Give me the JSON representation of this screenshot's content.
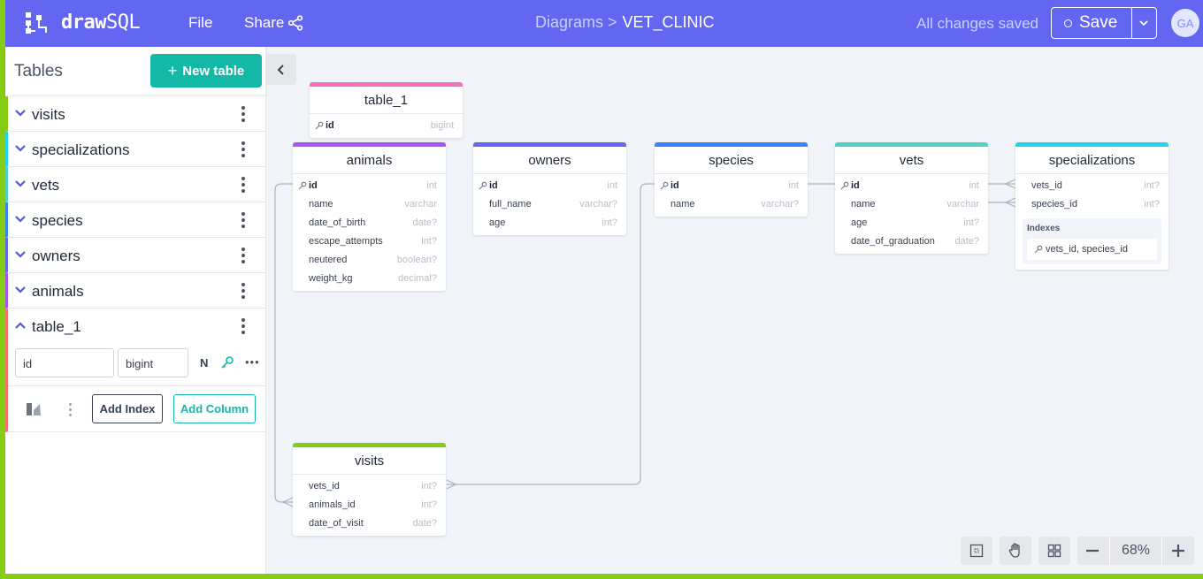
{
  "header": {
    "brand": "draw",
    "brand_suffix": "SQL",
    "file_label": "File",
    "share_label": "Share",
    "breadcrumb_parent": "Diagrams >",
    "breadcrumb_current": "VET_CLINIC",
    "status": "All changes saved",
    "save_label": "Save",
    "avatar_initials": "GA"
  },
  "sidebar": {
    "title": "Tables",
    "new_table_label": "New table",
    "tables": [
      {
        "name": "visits",
        "color": "#84cc16"
      },
      {
        "name": "specializations",
        "color": "#22d3ee"
      },
      {
        "name": "vets",
        "color": "#4fd1c5"
      },
      {
        "name": "species",
        "color": "#3b82f6"
      },
      {
        "name": "owners",
        "color": "#6366f1"
      },
      {
        "name": "animals",
        "color": "#a855f7"
      },
      {
        "name": "table_1",
        "color": "#f87171"
      }
    ],
    "expanded": {
      "column_name": "id",
      "column_type": "bigint",
      "nullable_label": "N",
      "add_index_label": "Add Index",
      "add_column_label": "Add Column"
    }
  },
  "diagram": {
    "indexes_label": "Indexes",
    "tables": {
      "table_1": {
        "title": "table_1",
        "color": "#f472b6",
        "columns": [
          {
            "name": "id",
            "type": "bigint",
            "pk": true
          }
        ]
      },
      "animals": {
        "title": "animals",
        "color": "#a855f7",
        "columns": [
          {
            "name": "id",
            "type": "int",
            "pk": true
          },
          {
            "name": "name",
            "type": "varchar"
          },
          {
            "name": "date_of_birth",
            "type": "date?"
          },
          {
            "name": "escape_attempts",
            "type": "int?"
          },
          {
            "name": "neutered",
            "type": "boolean?"
          },
          {
            "name": "weight_kg",
            "type": "decimal?"
          }
        ]
      },
      "owners": {
        "title": "owners",
        "color": "#6366f1",
        "columns": [
          {
            "name": "id",
            "type": "int",
            "pk": true
          },
          {
            "name": "full_name",
            "type": "varchar?"
          },
          {
            "name": "age",
            "type": "int?"
          }
        ]
      },
      "species": {
        "title": "species",
        "color": "#3b82f6",
        "columns": [
          {
            "name": "id",
            "type": "int",
            "pk": true
          },
          {
            "name": "name",
            "type": "varchar?"
          }
        ]
      },
      "vets": {
        "title": "vets",
        "color": "#4fd1c5",
        "columns": [
          {
            "name": "id",
            "type": "int",
            "pk": true
          },
          {
            "name": "name",
            "type": "varchar"
          },
          {
            "name": "age",
            "type": "int?"
          },
          {
            "name": "date_of_graduation",
            "type": "date?"
          }
        ]
      },
      "specializations": {
        "title": "specializations",
        "color": "#22d3ee",
        "columns": [
          {
            "name": "vets_id",
            "type": "int?"
          },
          {
            "name": "species_id",
            "type": "int?"
          }
        ],
        "index": "vets_id, species_id"
      },
      "visits": {
        "title": "visits",
        "color": "#84cc16",
        "columns": [
          {
            "name": "vets_id",
            "type": "int?"
          },
          {
            "name": "animals_id",
            "type": "int?"
          },
          {
            "name": "date_of_visit",
            "type": "date?"
          }
        ]
      }
    }
  },
  "zoom": {
    "level": "68%"
  }
}
